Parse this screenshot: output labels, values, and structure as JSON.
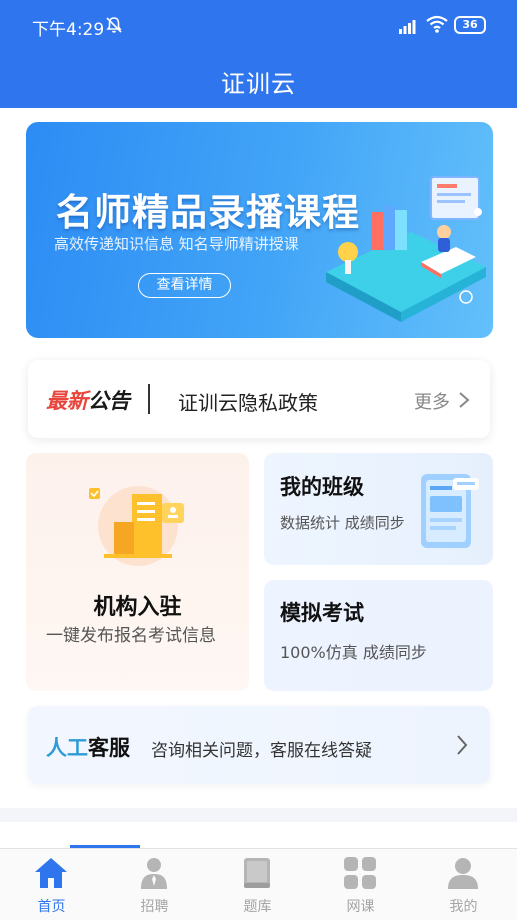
{
  "status_bar": {
    "time": "下午4:29",
    "battery": "36"
  },
  "nav": {
    "title": "证训云"
  },
  "banner": {
    "title": "名师精品录播课程",
    "subtitle": "高效传递知识信息 知名导师精讲授课",
    "button_label": "查看详情"
  },
  "notice": {
    "label_highlight": "最新",
    "label_rest": "公告",
    "text": "证训云隐私政策",
    "more_label": "更多"
  },
  "cards": {
    "institution": {
      "title": "机构入驻",
      "desc": "一键发布报名考试信息"
    },
    "my_class": {
      "title": "我的班级",
      "desc": "数据统计 成绩同步"
    },
    "mock_exam": {
      "title": "模拟考试",
      "desc": "100%仿真 成绩同步"
    }
  },
  "service": {
    "title_highlight": "人工",
    "title_rest": "客服",
    "desc": "咨询相关问题，客服在线答疑"
  },
  "tabbar": {
    "items": [
      {
        "label": "首页",
        "icon": "home-icon",
        "active": true
      },
      {
        "label": "招聘",
        "icon": "person-icon",
        "active": false
      },
      {
        "label": "题库",
        "icon": "book-icon",
        "active": false
      },
      {
        "label": "网课",
        "icon": "grid-icon",
        "active": false
      },
      {
        "label": "我的",
        "icon": "user-icon",
        "active": false
      }
    ]
  },
  "colors": {
    "primary": "#2f76ee",
    "notice_red": "#e8453c",
    "service_blue": "#2e9bd6",
    "tab_inactive": "#a5a5a5"
  }
}
